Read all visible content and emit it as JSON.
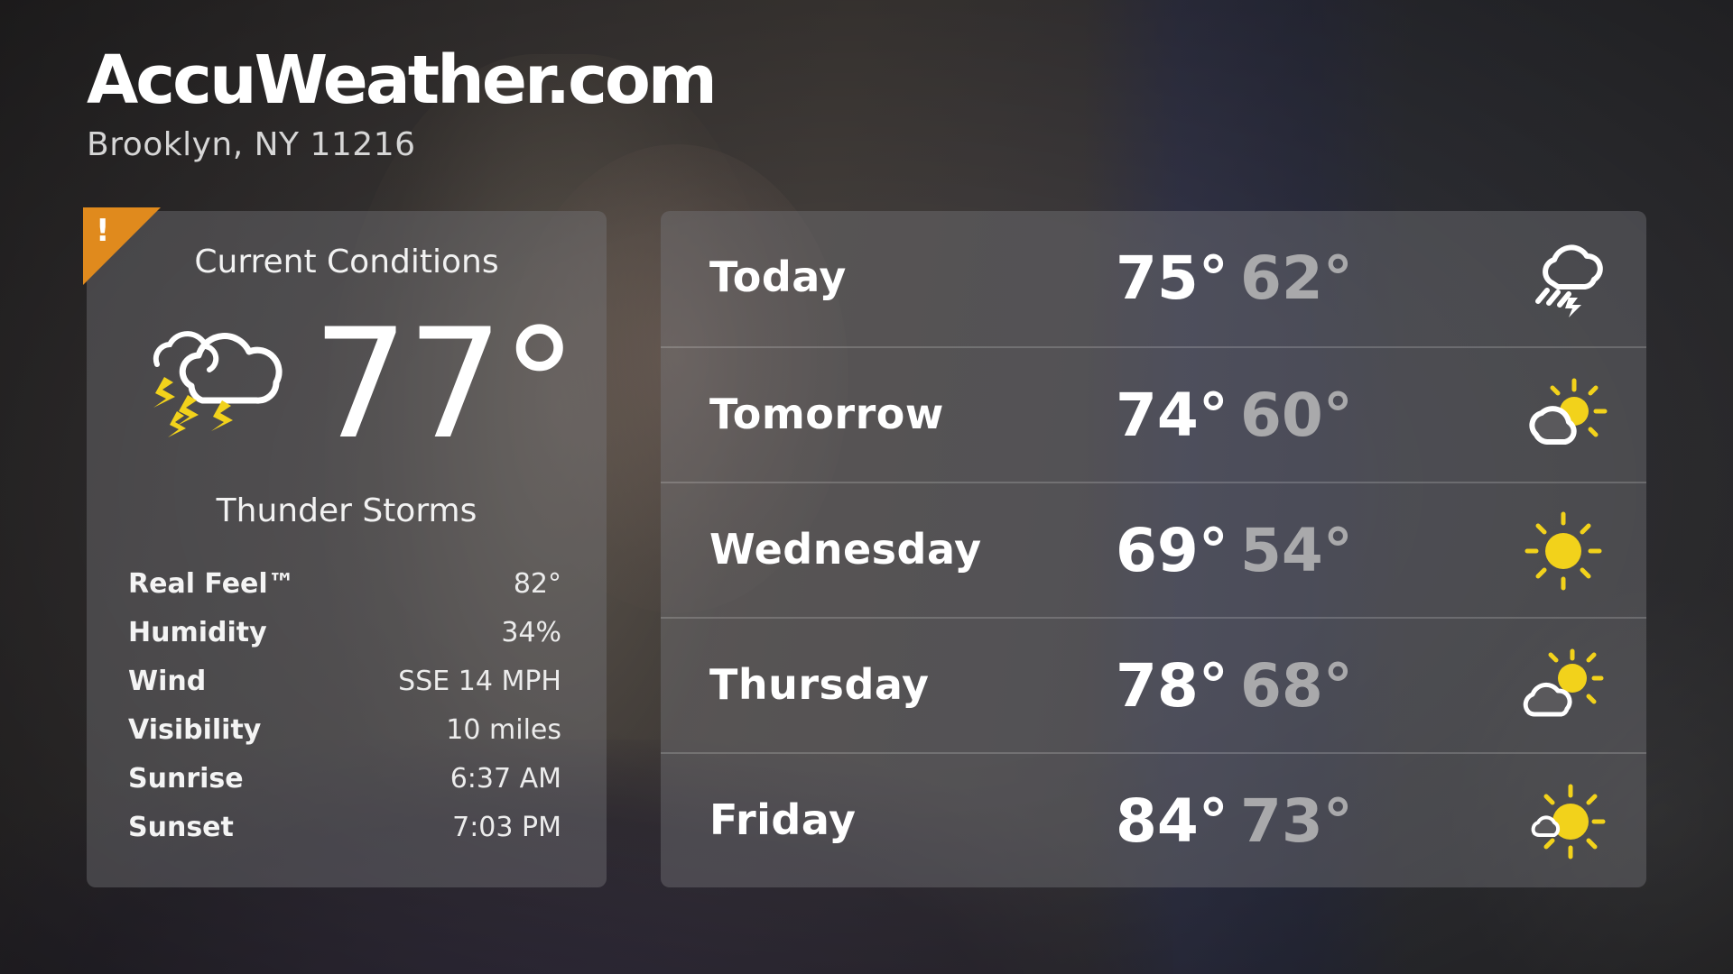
{
  "brand": "AccuWeather.com",
  "location": "Brooklyn, NY 11216",
  "alert_mark": "!",
  "current": {
    "title": "Current Conditions",
    "temperature": "77°",
    "condition": "Thunder Storms",
    "icon": "thunderstorm-icon",
    "details": [
      {
        "label": "Real Feel™",
        "value": "82°"
      },
      {
        "label": "Humidity",
        "value": "34%"
      },
      {
        "label": "Wind",
        "value": "SSE 14 MPH"
      },
      {
        "label": "Visibility",
        "value": "10 miles"
      },
      {
        "label": "Sunrise",
        "value": "6:37 AM"
      },
      {
        "label": "Sunset",
        "value": "7:03 PM"
      }
    ]
  },
  "forecast": [
    {
      "day": "Today",
      "high": "75°",
      "low": "62°",
      "icon": "rain-cloud-icon"
    },
    {
      "day": "Tomorrow",
      "high": "74°",
      "low": "60°",
      "icon": "partly-sunny-icon"
    },
    {
      "day": "Wednesday",
      "high": "69°",
      "low": "54°",
      "icon": "sun-icon"
    },
    {
      "day": "Thursday",
      "high": "78°",
      "low": "68°",
      "icon": "mostly-cloudy-sun-icon"
    },
    {
      "day": "Friday",
      "high": "84°",
      "low": "73°",
      "icon": "mostly-sunny-icon"
    }
  ],
  "colors": {
    "alert": "#e08a1d",
    "sun": "#f2d21b",
    "low_temp": "#a9a9ab"
  }
}
